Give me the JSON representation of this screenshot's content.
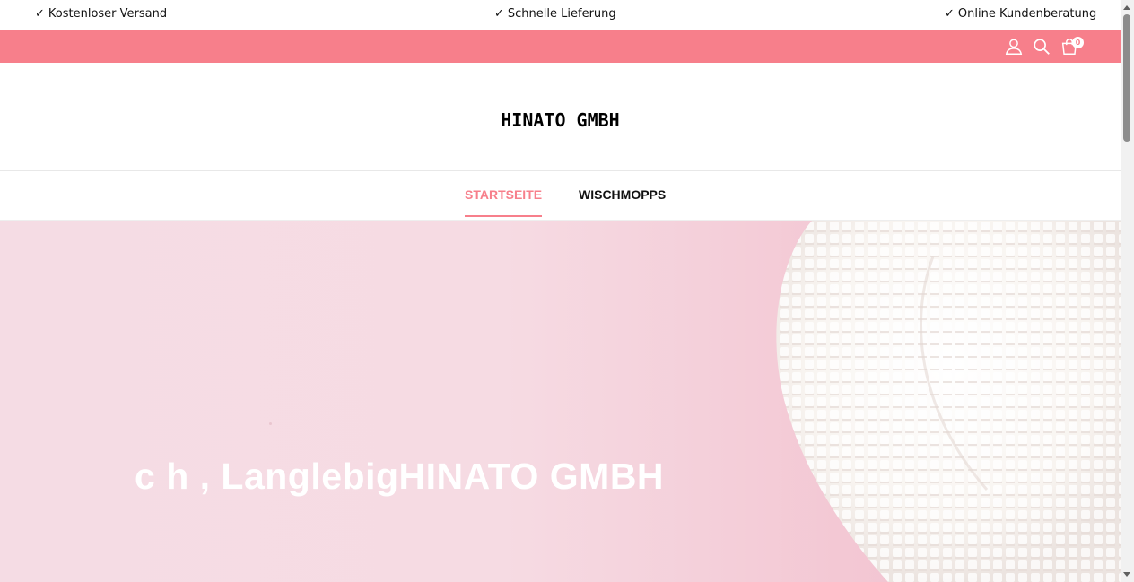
{
  "topbar": {
    "usps": [
      "Kostenloser Versand",
      "Schnelle Lieferung",
      "Online Kundenberatung"
    ]
  },
  "iconbar": {
    "color": "#f77f8b",
    "icons": [
      "user-icon",
      "search-icon",
      "cart-icon"
    ],
    "cart_count": "0"
  },
  "header": {
    "logo": "HINATO GMBH"
  },
  "nav": {
    "items": [
      "STARTSEITE",
      "WISCHMOPPS"
    ],
    "active": "STARTSEITE",
    "accent": "#f77f8b"
  },
  "hero": {
    "title": "c    h , LanglebigHINATO GMBH"
  }
}
